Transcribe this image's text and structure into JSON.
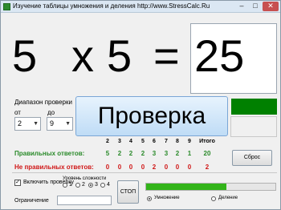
{
  "window": {
    "title": "Изучение таблицы умножения и деления     http://www.StressCalc.Ru",
    "minimize": "–",
    "maximize": "□",
    "close": "✕"
  },
  "problem": {
    "a": "5",
    "operator": "x",
    "b": "5",
    "equals": "=",
    "answer": "25"
  },
  "range": {
    "label": "Диапазон проверки",
    "from_label": "от",
    "from_value": "2",
    "to_label": "до",
    "to_value": "9"
  },
  "check_button": "Проверка",
  "status_color": "#008000",
  "stats": {
    "headers": [
      "2",
      "3",
      "4",
      "5",
      "6",
      "7",
      "8",
      "9"
    ],
    "total_header": "Итого",
    "correct_label": "Правильных ответов:",
    "correct": [
      "5",
      "2",
      "2",
      "2",
      "3",
      "3",
      "2",
      "1"
    ],
    "correct_total": "20",
    "wrong_label": "Не правильных ответов:",
    "wrong": [
      "0",
      "0",
      "0",
      "0",
      "2",
      "0",
      "0",
      "0"
    ],
    "wrong_total": "2",
    "correct_color": "#2a8a2a",
    "wrong_color": "#d01818"
  },
  "reset_button": "Сброс",
  "controls": {
    "enable_check_label": "Включить проверку",
    "enable_check_mark": "✓",
    "difficulty_label": "Уровень сложности",
    "levels": [
      "1",
      "2",
      "3",
      "4"
    ],
    "selected_level": "3",
    "limit_label": "Ограничение",
    "limit_value": "",
    "stop_button": "СТОП",
    "progress_fraction": 0.62,
    "mode_multiply": "Умножение",
    "mode_divide": "Деление",
    "selected_mode": "multiply"
  }
}
